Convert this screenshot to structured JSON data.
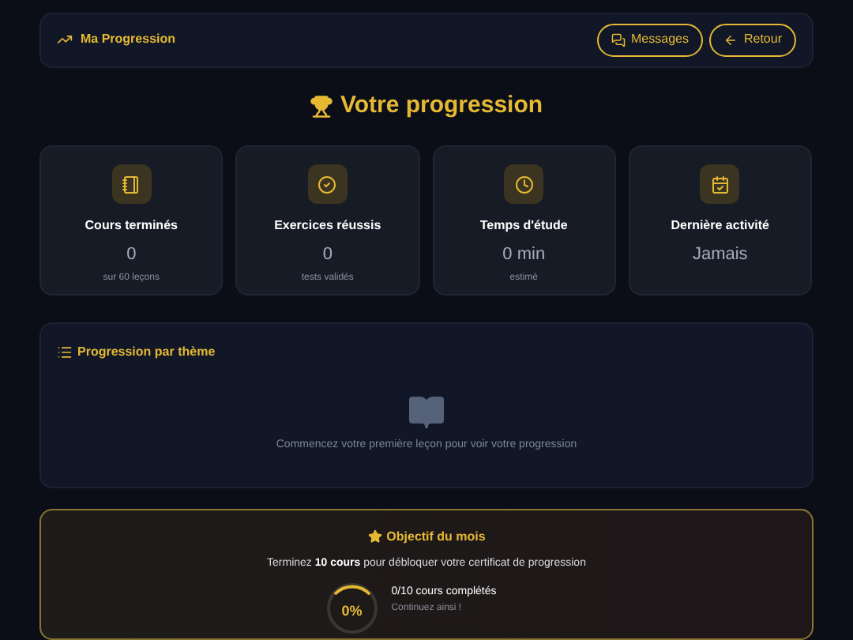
{
  "header": {
    "title": "Ma Progression",
    "buttons": [
      {
        "kind": "messages",
        "label": "Messages"
      },
      {
        "kind": "back",
        "label": "Retour"
      }
    ]
  },
  "page_title": "Votre progression",
  "stats": [
    {
      "kind": "book",
      "label": "Cours terminés",
      "value": "0",
      "caption": "sur 60 leçons"
    },
    {
      "kind": "check",
      "label": "Exercices réussis",
      "value": "0",
      "caption": "tests validés"
    },
    {
      "kind": "clock",
      "label": "Temps d'étude",
      "value": "0 min",
      "caption": "estimé"
    },
    {
      "kind": "calendar",
      "label": "Dernière activité",
      "value": "Jamais"
    }
  ],
  "themes": {
    "title": "Progression par thème",
    "empty_message": "Commencez votre première leçon pour voir votre progression"
  },
  "goal": {
    "title": "Objectif du mois",
    "text": "Terminez **10 cours** pour débloquer votre certificat de progression",
    "ring": {
      "level": 0,
      "reading": "0%"
    },
    "progress": "0/10 cours complétés",
    "hint": "Continuez ainsi !"
  }
}
